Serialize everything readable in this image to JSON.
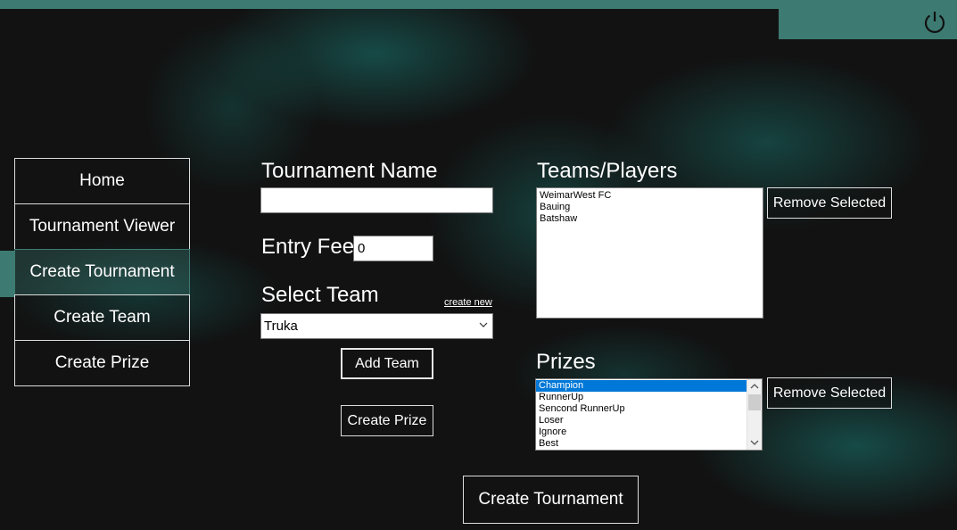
{
  "window": {
    "power_icon": "power-icon",
    "accent_color": "#3d7b72"
  },
  "sidebar": {
    "items": [
      {
        "label": "Home"
      },
      {
        "label": "Tournament Viewer"
      },
      {
        "label": "Create Tournament",
        "active": true
      },
      {
        "label": "Create Team"
      },
      {
        "label": "Create Prize"
      }
    ]
  },
  "form": {
    "tournament_name_label": "Tournament Name",
    "tournament_name_value": "",
    "entry_fee_label": "Entry Fee",
    "entry_fee_value": "0",
    "select_team_label": "Select Team",
    "create_new_link": "create new",
    "selected_team": "Truka",
    "add_team_button": "Add Team",
    "create_prize_button": "Create Prize",
    "create_tournament_button": "Create Tournament"
  },
  "teams_players": {
    "label": "Teams/Players",
    "items": [
      "WeimarWest FC",
      "Bauing",
      "Batshaw"
    ],
    "remove_button": "Remove Selected"
  },
  "prizes": {
    "label": "Prizes",
    "items": [
      "Champion",
      "RunnerUp",
      "Sencond RunnerUp",
      "Loser",
      "Ignore",
      "Best"
    ],
    "selected_index": 0,
    "remove_button": "Remove Selected"
  }
}
